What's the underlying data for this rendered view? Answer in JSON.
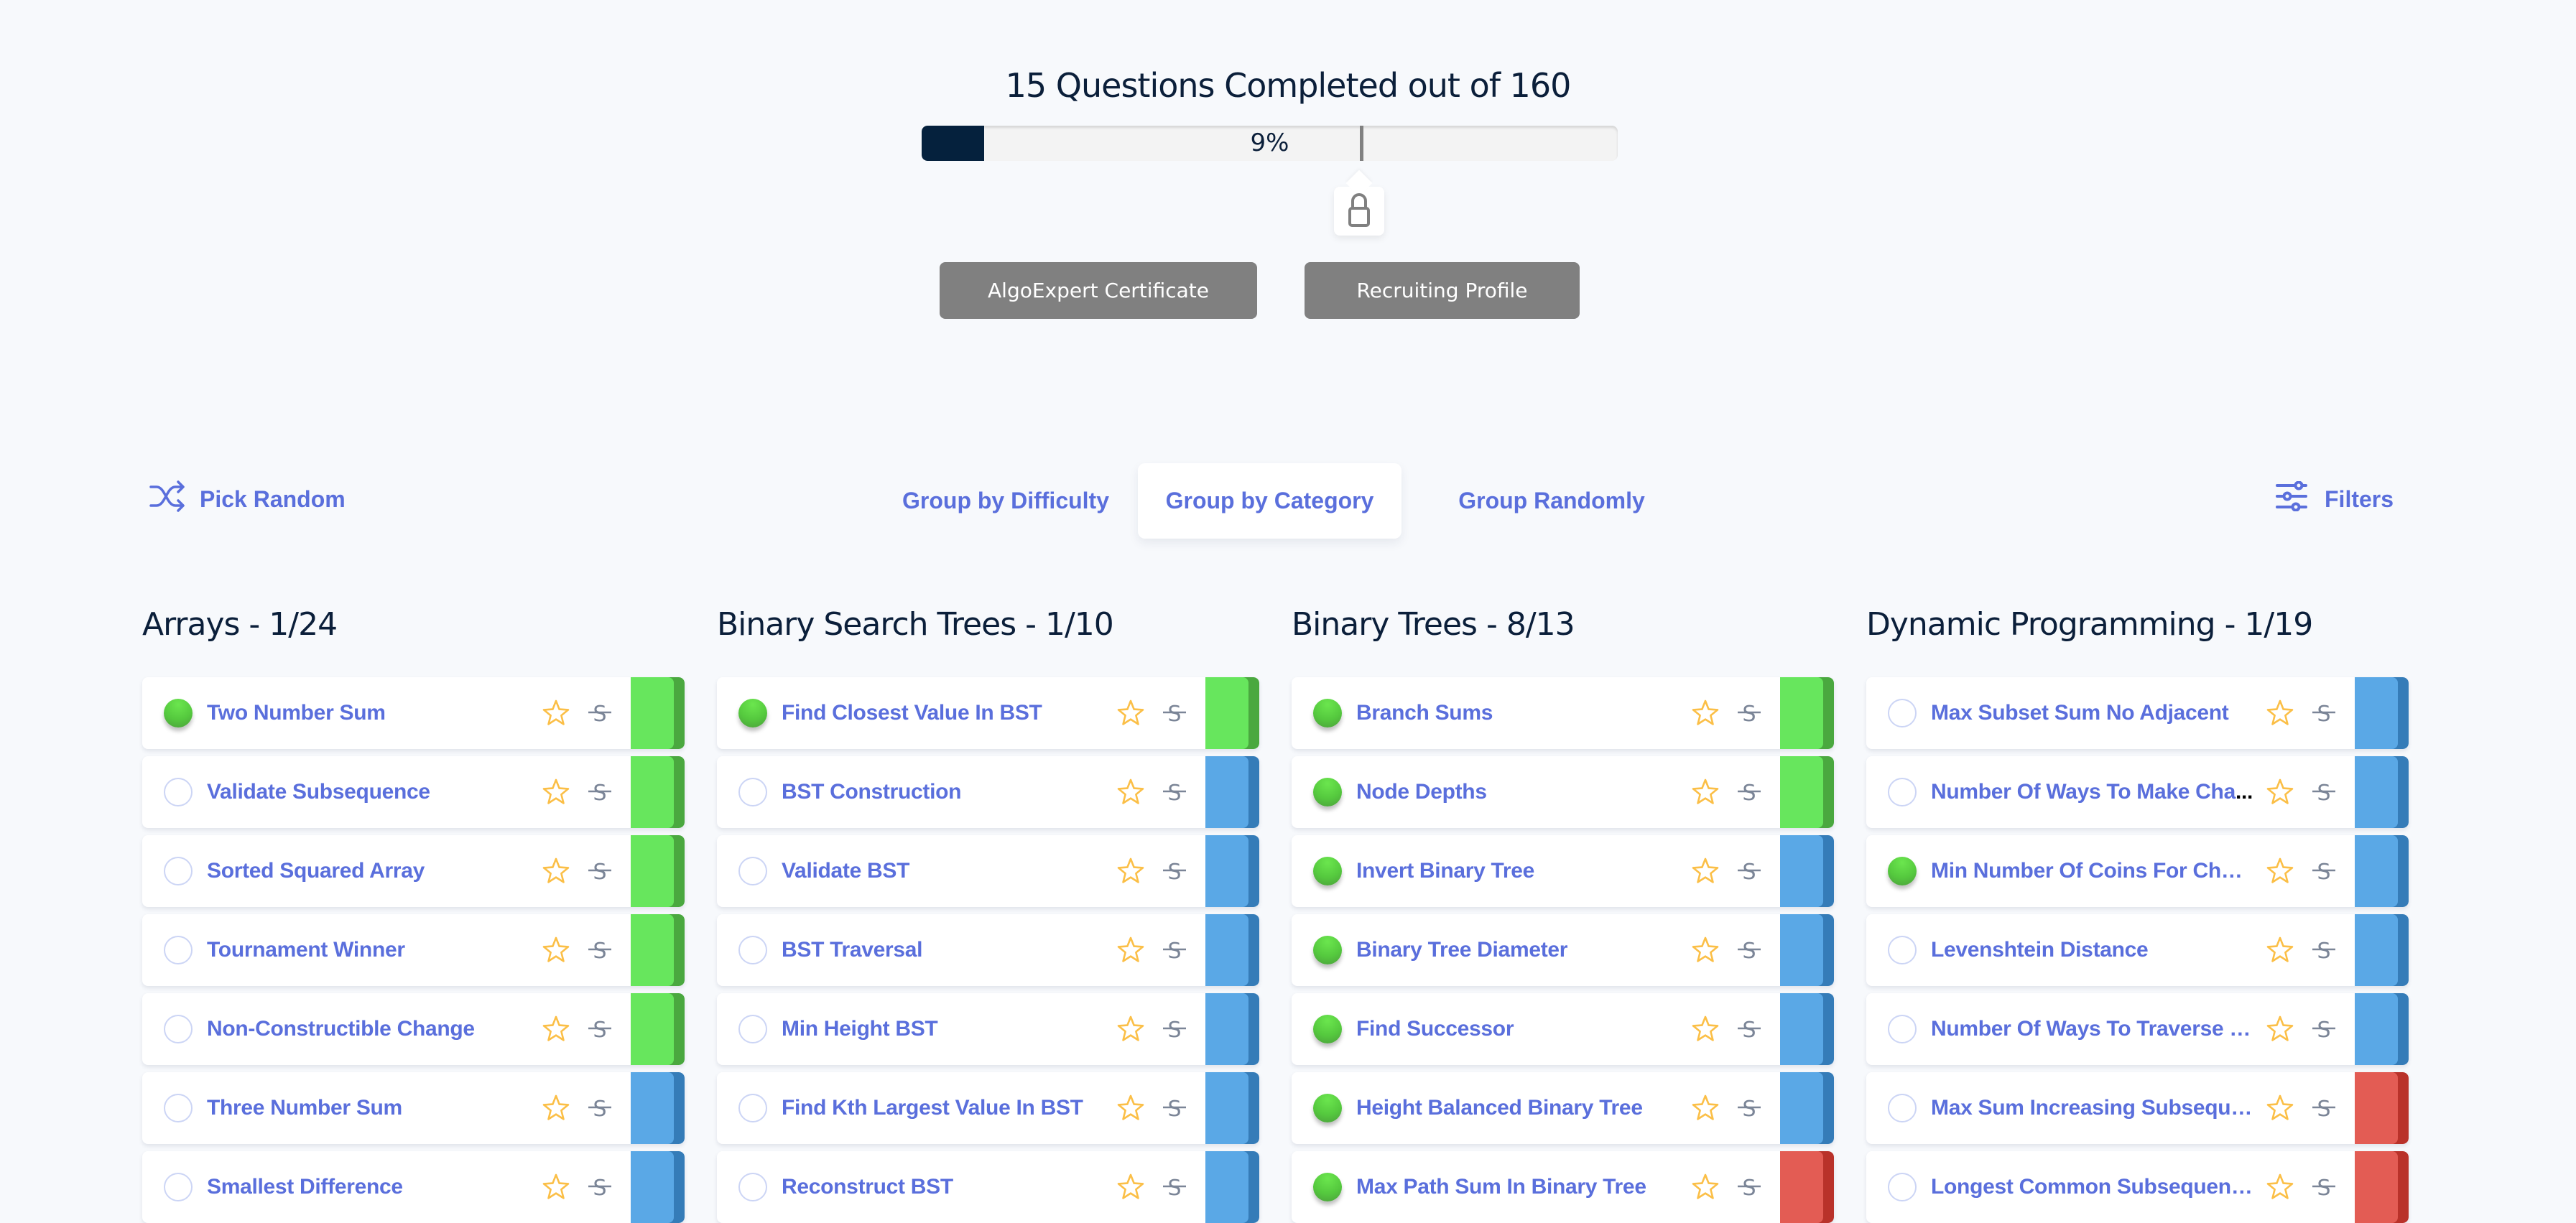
{
  "progress": {
    "title": "15 Questions Completed out of 160",
    "completed": 15,
    "total": 160,
    "percent_label": "9%",
    "percent": 9,
    "unlock_marker_percent": 63,
    "marker_icon": "lock-icon",
    "colors": {
      "fill": "#05213d",
      "track": "#f3f3f3",
      "marker": "#808080"
    }
  },
  "actions": {
    "certificate_label": "AlgoExpert Certificate",
    "recruiting_label": "Recruiting Profile"
  },
  "toolbar": {
    "pick_random_label": "Pick Random",
    "pick_random_icon": "shuffle-icon",
    "filters_label": "Filters",
    "filters_icon": "sliders-icon",
    "tabs": [
      {
        "label": "Group by Difficulty",
        "active": false
      },
      {
        "label": "Group by Category",
        "active": true
      },
      {
        "label": "Group Randomly",
        "active": false
      }
    ]
  },
  "colors": {
    "accent": "#5a6fdc",
    "heading": "#0b1f3a",
    "star": "#fbbf47",
    "easy": "#67e65d",
    "medium": "#5aa8e6",
    "hard": "#e35c54",
    "completed": "#55c93e"
  },
  "columns": [
    {
      "title": "Arrays - 1/24",
      "questions": [
        {
          "name": "Two Number Sum",
          "completed": true,
          "difficulty": "easy"
        },
        {
          "name": "Validate Subsequence",
          "completed": false,
          "difficulty": "easy"
        },
        {
          "name": "Sorted Squared Array",
          "completed": false,
          "difficulty": "easy"
        },
        {
          "name": "Tournament Winner",
          "completed": false,
          "difficulty": "easy"
        },
        {
          "name": "Non-Constructible Change",
          "completed": false,
          "difficulty": "easy"
        },
        {
          "name": "Three Number Sum",
          "completed": false,
          "difficulty": "medium"
        },
        {
          "name": "Smallest Difference",
          "completed": false,
          "difficulty": "medium"
        }
      ]
    },
    {
      "title": "Binary Search Trees - 1/10",
      "questions": [
        {
          "name": "Find Closest Value In BST",
          "completed": true,
          "difficulty": "easy"
        },
        {
          "name": "BST Construction",
          "completed": false,
          "difficulty": "medium"
        },
        {
          "name": "Validate BST",
          "completed": false,
          "difficulty": "medium"
        },
        {
          "name": "BST Traversal",
          "completed": false,
          "difficulty": "medium"
        },
        {
          "name": "Min Height BST",
          "completed": false,
          "difficulty": "medium"
        },
        {
          "name": "Find Kth Largest Value In BST",
          "completed": false,
          "difficulty": "medium"
        },
        {
          "name": "Reconstruct BST",
          "completed": false,
          "difficulty": "medium"
        }
      ]
    },
    {
      "title": "Binary Trees - 8/13",
      "questions": [
        {
          "name": "Branch Sums",
          "completed": true,
          "difficulty": "easy"
        },
        {
          "name": "Node Depths",
          "completed": true,
          "difficulty": "easy"
        },
        {
          "name": "Invert Binary Tree",
          "completed": true,
          "difficulty": "medium"
        },
        {
          "name": "Binary Tree Diameter",
          "completed": true,
          "difficulty": "medium"
        },
        {
          "name": "Find Successor",
          "completed": true,
          "difficulty": "medium"
        },
        {
          "name": "Height Balanced Binary Tree",
          "completed": true,
          "difficulty": "medium"
        },
        {
          "name": "Max Path Sum In Binary Tree",
          "completed": true,
          "difficulty": "hard"
        }
      ]
    },
    {
      "title": "Dynamic Programming - 1/19",
      "questions": [
        {
          "name": "Max Subset Sum No Adjacent",
          "completed": false,
          "difficulty": "medium"
        },
        {
          "name": "Number Of Ways To Make Cha",
          "truncated": true,
          "completed": false,
          "difficulty": "medium"
        },
        {
          "name": "Min Number Of Coins For Chan",
          "truncated": true,
          "completed": true,
          "difficulty": "medium"
        },
        {
          "name": "Levenshtein Distance",
          "completed": false,
          "difficulty": "medium"
        },
        {
          "name": "Number Of Ways To Traverse G",
          "truncated": true,
          "completed": false,
          "difficulty": "medium"
        },
        {
          "name": "Max Sum Increasing Subseque",
          "truncated": true,
          "completed": false,
          "difficulty": "hard"
        },
        {
          "name": "Longest Common Subsequence",
          "completed": false,
          "difficulty": "hard"
        }
      ]
    }
  ],
  "row_icons": {
    "favorite": "star-icon",
    "strike": "strikethrough-icon"
  }
}
